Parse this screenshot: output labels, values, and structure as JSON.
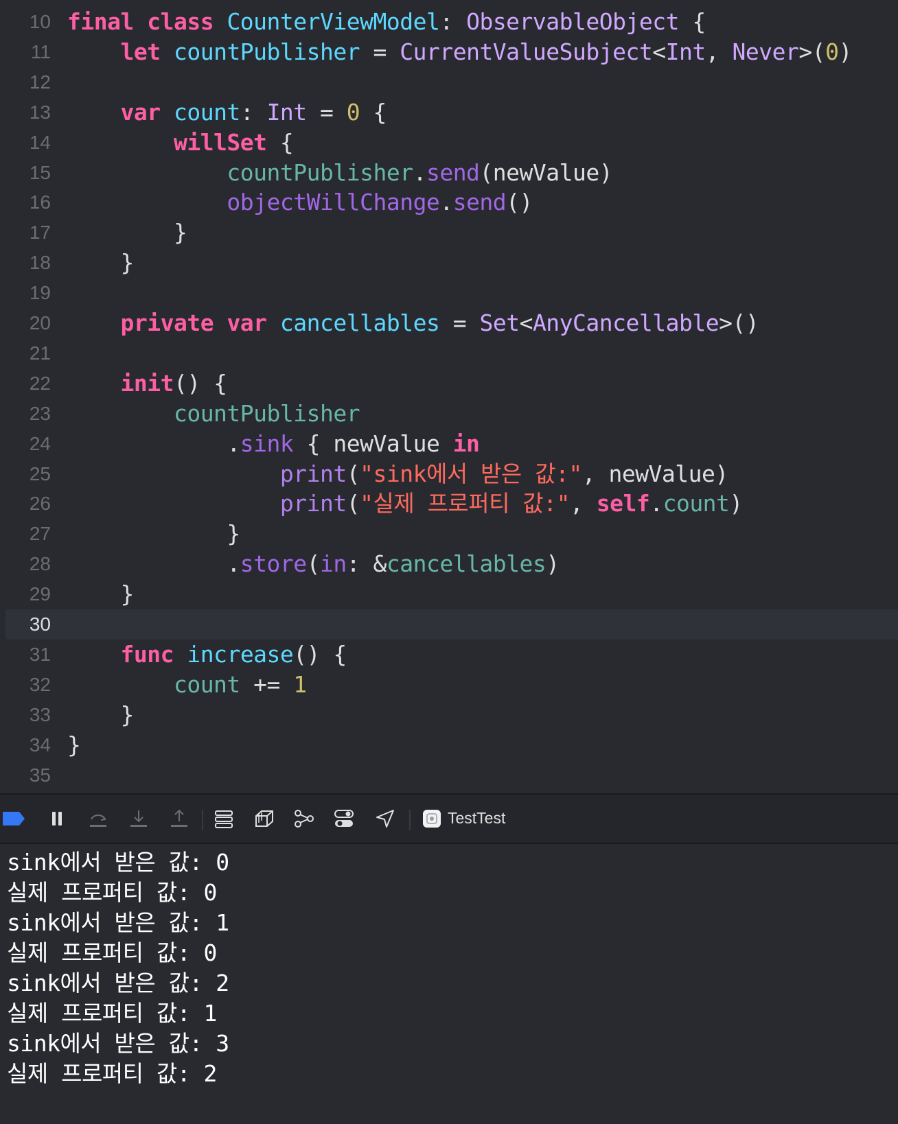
{
  "editor": {
    "current_line": "30",
    "lines": [
      {
        "n": "10",
        "tokens": [
          [
            "kw",
            "final"
          ],
          [
            "pl",
            " "
          ],
          [
            "kw",
            "class"
          ],
          [
            "pl",
            " "
          ],
          [
            "dec",
            "CounterViewModel"
          ],
          [
            "pl",
            ": "
          ],
          [
            "typ",
            "ObservableObject"
          ],
          [
            "pl",
            " {"
          ]
        ]
      },
      {
        "n": "11",
        "tokens": [
          [
            "pl",
            "    "
          ],
          [
            "kw",
            "let"
          ],
          [
            "pl",
            " "
          ],
          [
            "dec",
            "countPublisher"
          ],
          [
            "pl",
            " = "
          ],
          [
            "typ",
            "CurrentValueSubject"
          ],
          [
            "pl",
            "<"
          ],
          [
            "typ",
            "Int"
          ],
          [
            "pl",
            ", "
          ],
          [
            "typ",
            "Never"
          ],
          [
            "pl",
            ">("
          ],
          [
            "num",
            "0"
          ],
          [
            "pl",
            ")"
          ]
        ]
      },
      {
        "n": "12",
        "tokens": []
      },
      {
        "n": "13",
        "tokens": [
          [
            "pl",
            "    "
          ],
          [
            "kw",
            "var"
          ],
          [
            "pl",
            " "
          ],
          [
            "dec",
            "count"
          ],
          [
            "pl",
            ": "
          ],
          [
            "typ",
            "Int"
          ],
          [
            "pl",
            " = "
          ],
          [
            "num",
            "0"
          ],
          [
            "pl",
            " {"
          ]
        ]
      },
      {
        "n": "14",
        "tokens": [
          [
            "pl",
            "        "
          ],
          [
            "kw",
            "willSet"
          ],
          [
            "pl",
            " {"
          ]
        ]
      },
      {
        "n": "15",
        "tokens": [
          [
            "pl",
            "            "
          ],
          [
            "prop",
            "countPublisher"
          ],
          [
            "pl",
            "."
          ],
          [
            "met",
            "send"
          ],
          [
            "pl",
            "(newValue)"
          ]
        ]
      },
      {
        "n": "16",
        "tokens": [
          [
            "pl",
            "            "
          ],
          [
            "met",
            "objectWillChange"
          ],
          [
            "pl",
            "."
          ],
          [
            "met",
            "send"
          ],
          [
            "pl",
            "()"
          ]
        ]
      },
      {
        "n": "17",
        "tokens": [
          [
            "pl",
            "        }"
          ]
        ]
      },
      {
        "n": "18",
        "tokens": [
          [
            "pl",
            "    }"
          ]
        ]
      },
      {
        "n": "19",
        "tokens": []
      },
      {
        "n": "20",
        "tokens": [
          [
            "pl",
            "    "
          ],
          [
            "kw",
            "private"
          ],
          [
            "pl",
            " "
          ],
          [
            "kw",
            "var"
          ],
          [
            "pl",
            " "
          ],
          [
            "dec",
            "cancellables"
          ],
          [
            "pl",
            " = "
          ],
          [
            "typ",
            "Set"
          ],
          [
            "pl",
            "<"
          ],
          [
            "typ",
            "AnyCancellable"
          ],
          [
            "pl",
            ">()"
          ]
        ]
      },
      {
        "n": "21",
        "tokens": []
      },
      {
        "n": "22",
        "tokens": [
          [
            "pl",
            "    "
          ],
          [
            "kw",
            "init"
          ],
          [
            "pl",
            "() {"
          ]
        ]
      },
      {
        "n": "23",
        "tokens": [
          [
            "pl",
            "        "
          ],
          [
            "prop",
            "countPublisher"
          ]
        ]
      },
      {
        "n": "24",
        "tokens": [
          [
            "pl",
            "            ."
          ],
          [
            "met",
            "sink"
          ],
          [
            "pl",
            " { newValue "
          ],
          [
            "kw",
            "in"
          ]
        ]
      },
      {
        "n": "25",
        "tokens": [
          [
            "pl",
            "                "
          ],
          [
            "fn",
            "print"
          ],
          [
            "pl",
            "("
          ],
          [
            "str",
            "\"sink에서 받은 값:\""
          ],
          [
            "pl",
            ", newValue)"
          ]
        ]
      },
      {
        "n": "26",
        "tokens": [
          [
            "pl",
            "                "
          ],
          [
            "fn",
            "print"
          ],
          [
            "pl",
            "("
          ],
          [
            "str",
            "\"실제 프로퍼티 값:\""
          ],
          [
            "pl",
            ", "
          ],
          [
            "kw",
            "self"
          ],
          [
            "pl",
            "."
          ],
          [
            "prop",
            "count"
          ],
          [
            "pl",
            ")"
          ]
        ]
      },
      {
        "n": "27",
        "tokens": [
          [
            "pl",
            "            }"
          ]
        ]
      },
      {
        "n": "28",
        "tokens": [
          [
            "pl",
            "            ."
          ],
          [
            "met",
            "store"
          ],
          [
            "pl",
            "("
          ],
          [
            "met",
            "in"
          ],
          [
            "pl",
            ": &"
          ],
          [
            "prop",
            "cancellables"
          ],
          [
            "pl",
            ")"
          ]
        ]
      },
      {
        "n": "29",
        "tokens": [
          [
            "pl",
            "    }"
          ]
        ]
      },
      {
        "n": "30",
        "tokens": []
      },
      {
        "n": "31",
        "tokens": [
          [
            "pl",
            "    "
          ],
          [
            "kw",
            "func"
          ],
          [
            "pl",
            " "
          ],
          [
            "dec",
            "increase"
          ],
          [
            "pl",
            "() {"
          ]
        ]
      },
      {
        "n": "32",
        "tokens": [
          [
            "pl",
            "        "
          ],
          [
            "prop",
            "count"
          ],
          [
            "pl",
            " += "
          ],
          [
            "num",
            "1"
          ]
        ]
      },
      {
        "n": "33",
        "tokens": [
          [
            "pl",
            "    }"
          ]
        ]
      },
      {
        "n": "34",
        "tokens": [
          [
            "pl",
            "}"
          ]
        ]
      },
      {
        "n": "35",
        "tokens": []
      }
    ]
  },
  "toolbar": {
    "scheme_name": "TestTest",
    "buttons": [
      {
        "name": "breakpoints-toggle-button",
        "icon": "breakpoint-icon"
      },
      {
        "name": "pause-button",
        "icon": "pause-icon"
      },
      {
        "name": "step-over-button",
        "icon": "step-over-icon"
      },
      {
        "name": "step-into-button",
        "icon": "step-into-icon"
      },
      {
        "name": "step-out-button",
        "icon": "step-out-icon"
      },
      {
        "name": "debug-view-hierarchy-button",
        "icon": "view-hierarchy-icon"
      },
      {
        "name": "memory-graph-button",
        "icon": "layers-icon"
      },
      {
        "name": "memory-graph-nodes-button",
        "icon": "graph-nodes-icon"
      },
      {
        "name": "environment-overrides-button",
        "icon": "toggles-icon"
      },
      {
        "name": "simulate-location-button",
        "icon": "location-arrow-icon"
      }
    ],
    "accent": "#3478f6"
  },
  "console": {
    "lines": [
      "sink에서 받은 값: 0",
      "실제 프로퍼티 값: 0",
      "sink에서 받은 값: 1",
      "실제 프로퍼티 값: 0",
      "sink에서 받은 값: 2",
      "실제 프로퍼티 값: 1",
      "sink에서 받은 값: 3",
      "실제 프로퍼티 값: 2"
    ]
  }
}
